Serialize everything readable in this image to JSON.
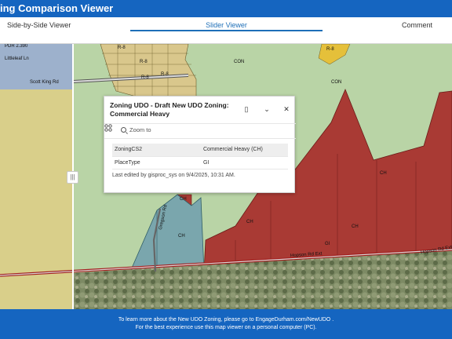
{
  "header": {
    "title": "ing Comparison Viewer"
  },
  "tabs": [
    {
      "label": "Side-by-Side Viewer",
      "active": false
    },
    {
      "label": "Slider Viewer",
      "active": true
    },
    {
      "label": "Comment",
      "active": false
    }
  ],
  "map": {
    "labels": [
      {
        "text": "PDR 2.390"
      },
      {
        "text": "Littleleaf Ln"
      },
      {
        "text": "Scott King Rd"
      },
      {
        "text": "R-8"
      },
      {
        "text": "CON"
      },
      {
        "text": "CH"
      },
      {
        "text": "GI"
      },
      {
        "text": "Hopson Rd Ext"
      },
      {
        "text": "Gregson Rd"
      }
    ],
    "colors": {
      "yellow_zone": "#d9cf8a",
      "blue_zone": "#8fa7c4",
      "con_zone": "#b9d4a6",
      "ch_zone": "#a93a34",
      "gi_zone": "#7aa6ad",
      "r8_parcels": "#d9c78c",
      "road_red": "#a31d1d",
      "brand_blue": "#1565c0"
    }
  },
  "slider": {
    "handle_icon": "drag-handle-icon",
    "glyph": "|||"
  },
  "popup": {
    "title": "Zoning UDO - Draft New UDO Zoning: Commercial Heavy",
    "dock_icon": "▯",
    "collapse_icon": "⌄",
    "close_icon": "✕",
    "zoom_label": "Zoom to",
    "fields": [
      {
        "key": "ZoningCS2",
        "value": "Commercial Heavy (CH)"
      },
      {
        "key": "PlaceType",
        "value": "GI"
      }
    ],
    "footer": "Last edited by gisproc_sys on 9/4/2025, 10:31 AM."
  },
  "footer": {
    "line1": "To learn more about the New UDO Zoning, please go to EngageDurham.com/NewUDO .",
    "line2": "For the best experience use this map viewer on a personal computer (PC)."
  }
}
